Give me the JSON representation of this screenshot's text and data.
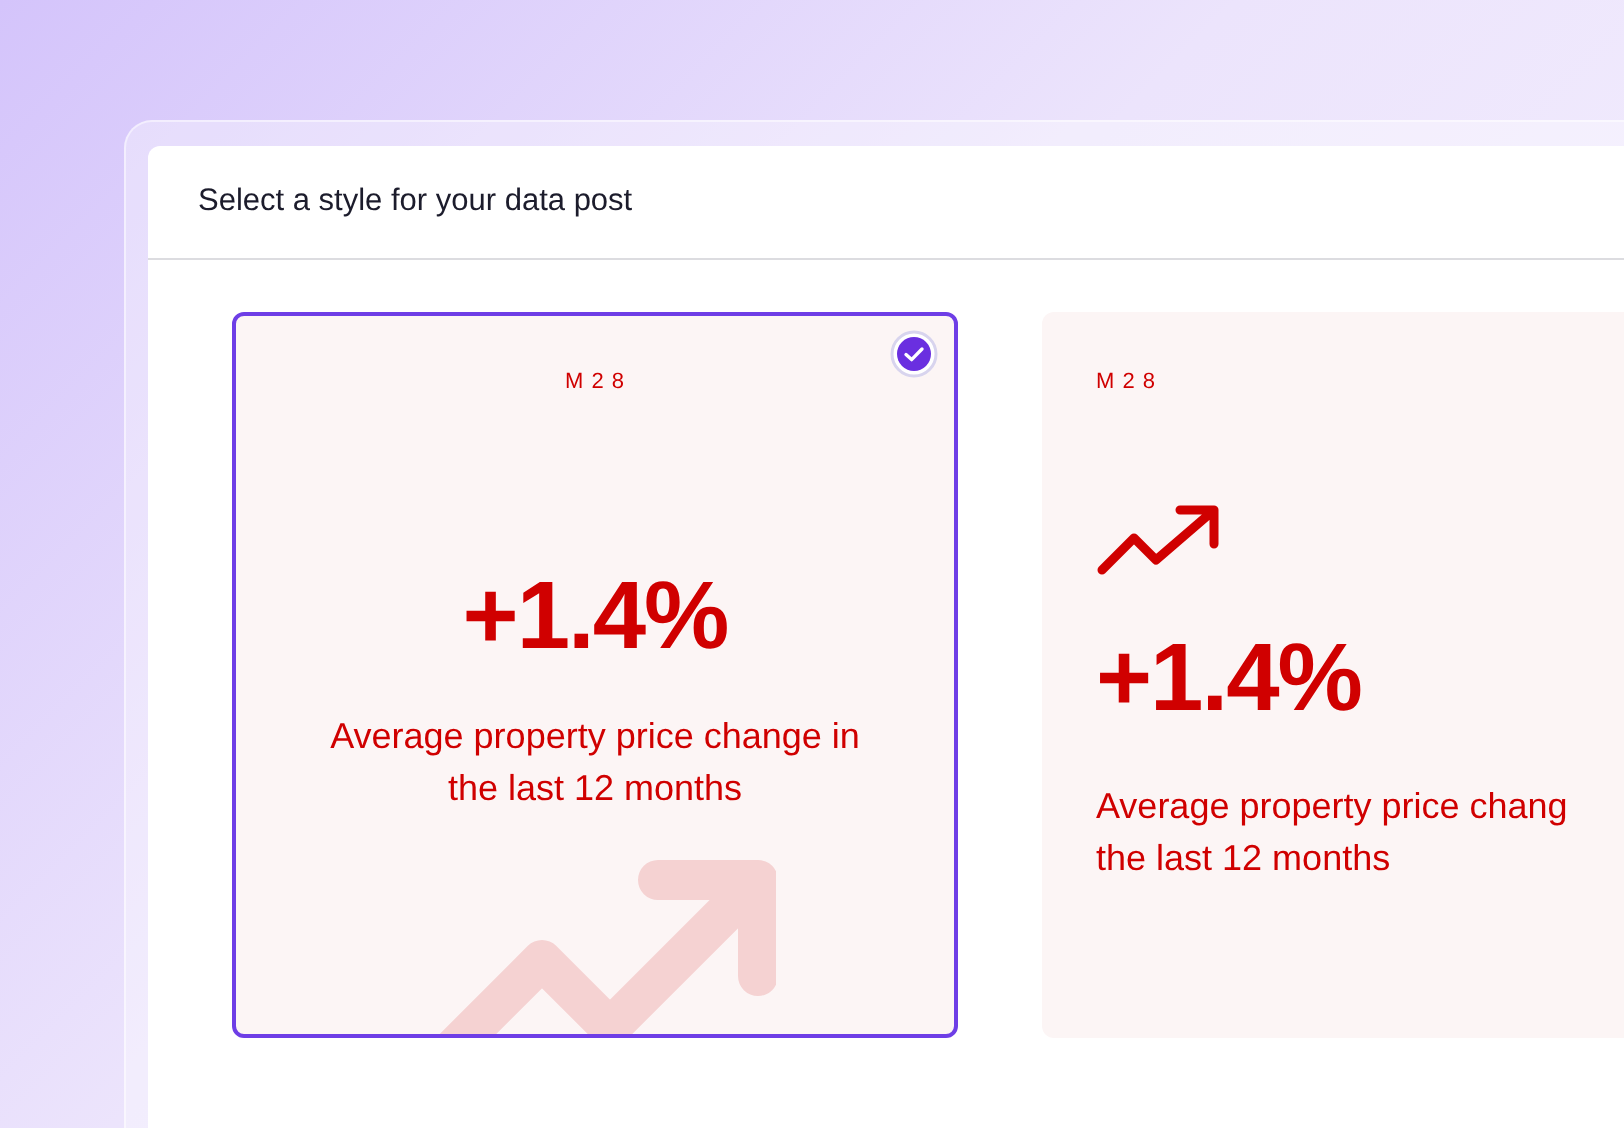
{
  "panel": {
    "title": "Select a style for your data post"
  },
  "cards": [
    {
      "kind": "centered",
      "selected": true,
      "brand": "M 2 8",
      "value": "+1.4%",
      "description_lines": [
        "Average property price change in",
        "the last 12 months"
      ]
    },
    {
      "kind": "left",
      "selected": false,
      "brand": "M 2 8",
      "value": "+1.4%",
      "description_lines": [
        "Average property price chang",
        "the last 12 months"
      ]
    }
  ]
}
